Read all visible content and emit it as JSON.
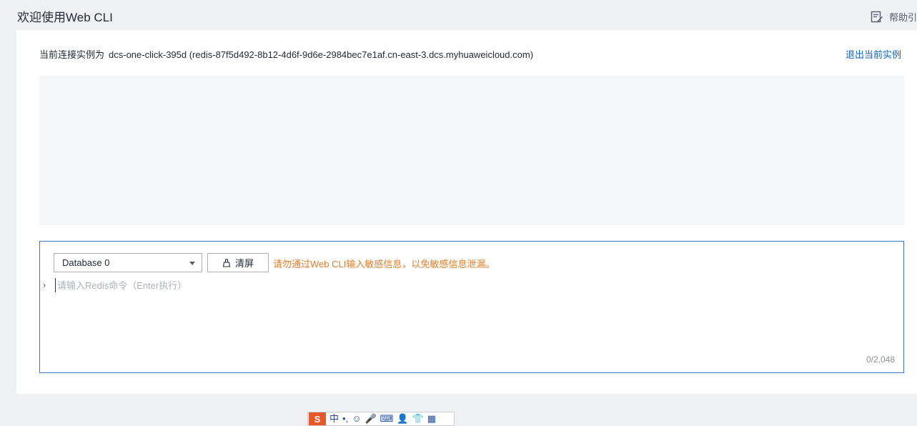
{
  "header": {
    "title": "欢迎使用Web CLI",
    "help_label": "帮助引"
  },
  "connection": {
    "label": "当前连接实例为",
    "instance": "dcs-one-click-395d (redis-87f5d492-8b12-4d6f-9d6e-2984bec7e1af.cn-east-3.dcs.myhuaweicloud.com)",
    "exit_label": "退出当前实例"
  },
  "console": {
    "database_selected": "Database 0",
    "clear_label": "清屏",
    "warning": "请勿通过Web CLI输入敏感信息，以免敏感信息泄漏。",
    "prompt_symbol": "›",
    "input_placeholder": "请输入Redis命令（Enter执行）",
    "input_value": "",
    "counter": "0/2,048"
  },
  "ime_toolbar": {
    "logo": "S",
    "items": [
      "中",
      "•,",
      "☺",
      "🎤",
      "⌨",
      "👤",
      "👕",
      "▦"
    ]
  },
  "colors": {
    "accent_link": "#0c62c0",
    "warning": "#e37d29",
    "console_border": "#3a77c0",
    "output_bg": "#f5f6f7",
    "page_bg": "#eef0f4"
  }
}
